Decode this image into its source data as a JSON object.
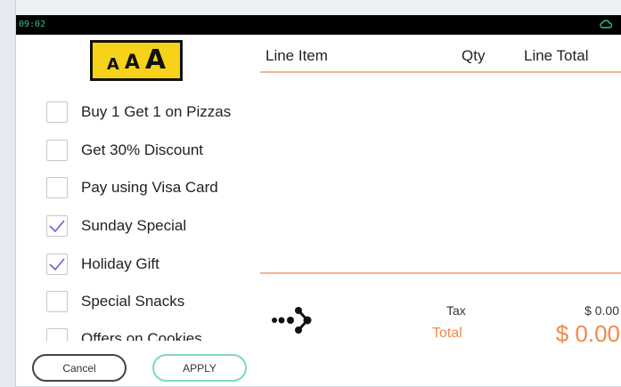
{
  "status_bar": {
    "time": "09:02",
    "cloud_icon": "cloud-icon"
  },
  "logo": {
    "letters": [
      "A",
      "A",
      "A"
    ],
    "color": "#f6d21b"
  },
  "promotions": [
    {
      "label": "Buy 1 Get 1 on Pizzas",
      "checked": false
    },
    {
      "label": "Get 30% Discount",
      "checked": false
    },
    {
      "label": "Pay using Visa Card",
      "checked": false
    },
    {
      "label": "Sunday Special",
      "checked": true
    },
    {
      "label": "Holiday Gift",
      "checked": true
    },
    {
      "label": "Special Snacks",
      "checked": false
    },
    {
      "label": "Offers on Cookies",
      "checked": false
    }
  ],
  "buttons": {
    "cancel": "Cancel",
    "apply": "APPLY"
  },
  "cart": {
    "columns": {
      "item": "Line Item",
      "qty": "Qty",
      "total": "Line Total"
    },
    "rows": []
  },
  "summary": {
    "tax_label": "Tax",
    "tax_value": "$ 0.00",
    "total_label": "Total",
    "total_value": "$ 0.00"
  },
  "colors": {
    "accent": "#f28a4a",
    "apply_border": "#7fd9b8",
    "check_mark": "#6b5fd1",
    "status_text": "#2fbf8f"
  }
}
